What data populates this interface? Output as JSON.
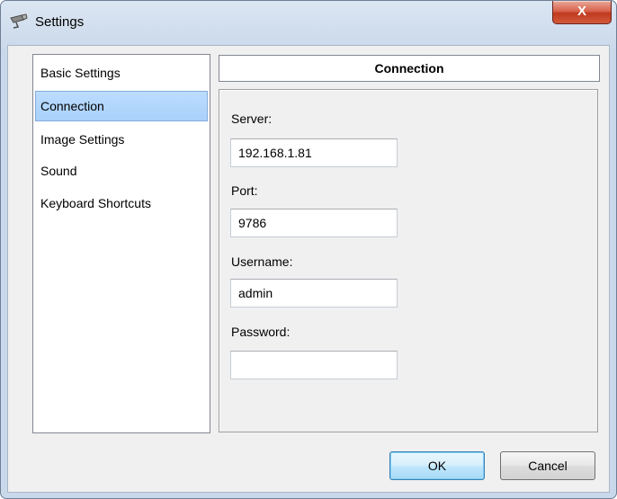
{
  "window": {
    "title": "Settings",
    "close_label": "X"
  },
  "nav": {
    "items": [
      {
        "label": "Basic Settings",
        "selected": false
      },
      {
        "label": "Connection",
        "selected": true
      },
      {
        "label": "Image Settings",
        "selected": false
      },
      {
        "label": "Sound",
        "selected": false
      },
      {
        "label": "Keyboard Shortcuts",
        "selected": false
      }
    ]
  },
  "section": {
    "title": "Connection"
  },
  "fields": {
    "server": {
      "label": "Server:",
      "value": "192.168.1.81"
    },
    "port": {
      "label": "Port:",
      "value": "9786"
    },
    "username": {
      "label": "Username:",
      "value": "admin"
    },
    "password": {
      "label": "Password:",
      "value": ""
    }
  },
  "buttons": {
    "ok": "OK",
    "cancel": "Cancel"
  },
  "colors": {
    "selection": "#a9d1fb",
    "close_button": "#c0391f"
  },
  "icons": {
    "app": "camera-icon",
    "close": "close-icon"
  }
}
